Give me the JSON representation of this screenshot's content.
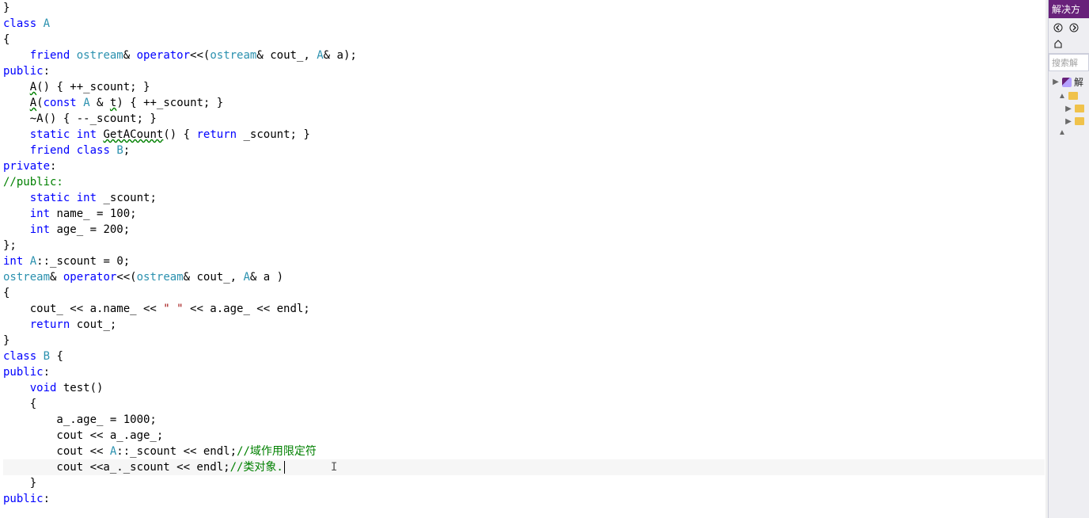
{
  "colors": {
    "keyword": "#0000ff",
    "type": "#2b91af",
    "string": "#a31515",
    "comment": "#008000",
    "panel_accent": "#68217a"
  },
  "side_panel": {
    "title": "解决方",
    "search_placeholder": "搜索解",
    "toolbar_icons": [
      "back-icon",
      "forward-icon",
      "home-icon"
    ],
    "tree": [
      {
        "indent": 0,
        "arrow": "▶",
        "icon": "sln-icon",
        "label": "解"
      },
      {
        "indent": 1,
        "arrow": "▲",
        "icon": "folder-icon",
        "label": ""
      },
      {
        "indent": 2,
        "arrow": "▶",
        "icon": "folder-icon",
        "label": ""
      },
      {
        "indent": 2,
        "arrow": "▶",
        "icon": "folder-icon",
        "label": ""
      },
      {
        "indent": 1,
        "arrow": "▲",
        "icon": "",
        "label": ""
      }
    ]
  },
  "code_lines": [
    {
      "segs": [
        {
          "t": "}",
          "c": ""
        }
      ]
    },
    {
      "segs": [
        {
          "t": "class",
          "c": "kw"
        },
        {
          "t": " "
        },
        {
          "t": "A",
          "c": "type"
        }
      ]
    },
    {
      "segs": [
        {
          "t": "{",
          "c": ""
        }
      ]
    },
    {
      "segs": [
        {
          "t": "    "
        },
        {
          "t": "friend",
          "c": "kw"
        },
        {
          "t": " "
        },
        {
          "t": "ostream",
          "c": "type"
        },
        {
          "t": "& "
        },
        {
          "t": "operator",
          "c": "kw"
        },
        {
          "t": "<<("
        },
        {
          "t": "ostream",
          "c": "type"
        },
        {
          "t": "& cout_, "
        },
        {
          "t": "A",
          "c": "type"
        },
        {
          "t": "& a);"
        }
      ]
    },
    {
      "segs": [
        {
          "t": "public",
          "c": "kw"
        },
        {
          "t": ":"
        }
      ]
    },
    {
      "segs": [
        {
          "t": "    "
        },
        {
          "t": "A",
          "c": "wavy-green"
        },
        {
          "t": "() { ++_scount; }"
        }
      ]
    },
    {
      "segs": [
        {
          "t": "    "
        },
        {
          "t": "A",
          "c": "wavy-green"
        },
        {
          "t": "("
        },
        {
          "t": "const",
          "c": "kw"
        },
        {
          "t": " "
        },
        {
          "t": "A",
          "c": "type"
        },
        {
          "t": " & "
        },
        {
          "t": "t",
          "c": "wavy-green"
        },
        {
          "t": ") { ++_scount; }"
        }
      ]
    },
    {
      "segs": [
        {
          "t": "    ~A() { --_scount; }"
        }
      ]
    },
    {
      "segs": [
        {
          "t": "    "
        },
        {
          "t": "static",
          "c": "kw"
        },
        {
          "t": " "
        },
        {
          "t": "int",
          "c": "kw"
        },
        {
          "t": " "
        },
        {
          "t": "GetACount",
          "c": "wavy-green"
        },
        {
          "t": "() { "
        },
        {
          "t": "return",
          "c": "kw"
        },
        {
          "t": " _scount; }"
        }
      ]
    },
    {
      "segs": [
        {
          "t": "    "
        },
        {
          "t": "friend",
          "c": "kw"
        },
        {
          "t": " "
        },
        {
          "t": "class",
          "c": "kw"
        },
        {
          "t": " "
        },
        {
          "t": "B",
          "c": "type"
        },
        {
          "t": ";"
        }
      ]
    },
    {
      "segs": [
        {
          "t": "private",
          "c": "kw"
        },
        {
          "t": ":"
        }
      ]
    },
    {
      "segs": [
        {
          "t": "//public:",
          "c": "cmt"
        }
      ]
    },
    {
      "segs": [
        {
          "t": "    "
        },
        {
          "t": "static",
          "c": "kw"
        },
        {
          "t": " "
        },
        {
          "t": "int",
          "c": "kw"
        },
        {
          "t": " _scount;"
        }
      ]
    },
    {
      "segs": [
        {
          "t": "    "
        },
        {
          "t": "int",
          "c": "kw"
        },
        {
          "t": " name_ = 100;"
        }
      ]
    },
    {
      "segs": [
        {
          "t": "    "
        },
        {
          "t": "int",
          "c": "kw"
        },
        {
          "t": " age_ = 200;"
        }
      ]
    },
    {
      "segs": [
        {
          "t": "};"
        }
      ]
    },
    {
      "segs": [
        {
          "t": "int",
          "c": "kw"
        },
        {
          "t": " "
        },
        {
          "t": "A",
          "c": "type"
        },
        {
          "t": "::_scount = 0;"
        }
      ]
    },
    {
      "segs": [
        {
          "t": "ostream",
          "c": "type"
        },
        {
          "t": "& "
        },
        {
          "t": "operator",
          "c": "kw"
        },
        {
          "t": "<<("
        },
        {
          "t": "ostream",
          "c": "type"
        },
        {
          "t": "& cout_, "
        },
        {
          "t": "A",
          "c": "type"
        },
        {
          "t": "& a )"
        }
      ]
    },
    {
      "segs": [
        {
          "t": "{"
        }
      ]
    },
    {
      "segs": [
        {
          "t": "    cout_ << a.name_ << "
        },
        {
          "t": "\" \"",
          "c": "str"
        },
        {
          "t": " << a.age_ << endl;"
        }
      ]
    },
    {
      "segs": [
        {
          "t": "    "
        },
        {
          "t": "return",
          "c": "kw"
        },
        {
          "t": " cout_;"
        }
      ]
    },
    {
      "segs": [
        {
          "t": "}"
        }
      ]
    },
    {
      "segs": [
        {
          "t": "class",
          "c": "kw"
        },
        {
          "t": " "
        },
        {
          "t": "B",
          "c": "type"
        },
        {
          "t": " {"
        }
      ]
    },
    {
      "segs": [
        {
          "t": "public",
          "c": "kw"
        },
        {
          "t": ":"
        }
      ]
    },
    {
      "segs": [
        {
          "t": "    "
        },
        {
          "t": "void",
          "c": "kw"
        },
        {
          "t": " test()"
        }
      ]
    },
    {
      "segs": [
        {
          "t": "    {"
        }
      ]
    },
    {
      "segs": [
        {
          "t": "        a_.age_ = 1000;"
        }
      ]
    },
    {
      "segs": [
        {
          "t": "        cout << a_.age_;"
        }
      ]
    },
    {
      "segs": [
        {
          "t": "        cout << "
        },
        {
          "t": "A",
          "c": "type"
        },
        {
          "t": "::_scount << endl;"
        },
        {
          "t": "//域作用限定符",
          "c": "cmt"
        }
      ]
    },
    {
      "segs": [
        {
          "t": "        cout <<a_._scount << endl;"
        },
        {
          "t": "//类对象.",
          "c": "cmt"
        }
      ],
      "current": true,
      "caret_after": true
    },
    {
      "segs": [
        {
          "t": "    }"
        }
      ]
    },
    {
      "segs": [
        {
          "t": "public",
          "c": "kw"
        },
        {
          "t": ":"
        }
      ]
    }
  ]
}
